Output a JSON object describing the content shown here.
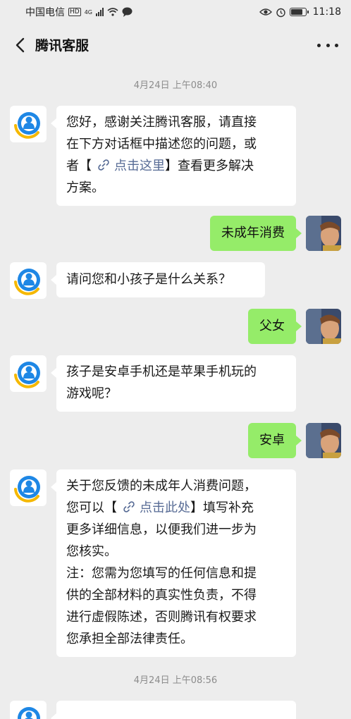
{
  "status_bar": {
    "carrier": "中国电信",
    "hd": "HD",
    "network": "4G",
    "time": "11:18"
  },
  "header": {
    "title": "腾讯客服",
    "back_icon": "chevron-left-icon",
    "more_icon": "more-dots-icon"
  },
  "chat": {
    "timestamps": [
      "4月24日 上午08:40",
      "4月24日 上午08:56"
    ],
    "m1": {
      "line1": "您好，感谢关注腾讯客服，请直接",
      "line2": "在下方对话框中描述您的问题，或",
      "line3_before": "者【",
      "line3_link": "点击这里",
      "line3_after": "】查看更多解决",
      "line4": "方案。"
    },
    "r1": "未成年消费",
    "m2": "请问您和小孩子是什么关系？",
    "r2": "父女",
    "m3": {
      "line1": "孩子是安卓手机还是苹果手机玩的",
      "line2": "游戏呢？"
    },
    "r3": "安卓",
    "m4": {
      "line1": "关于您反馈的未成年人消费问题，",
      "line2_before": "您可以【",
      "line2_link": "点击此处",
      "line2_after": "】填写补充",
      "line3": "更多详细信息，以便我们进一步为",
      "line4": "您核实。",
      "line5": "注：您需为您填写的任何信息和提",
      "line6": "供的全部材料的真实性负责，不得",
      "line7": "进行虚假陈述，否则腾讯有权要求",
      "line8": "您承担全部法律责任。"
    }
  },
  "colors": {
    "background": "#ededed",
    "bubble_self": "#95ec69",
    "bubble_other": "#ffffff",
    "link": "#576b95",
    "bot_avatar_blue": "#1e87e5",
    "bot_avatar_yellow": "#f5b800"
  }
}
